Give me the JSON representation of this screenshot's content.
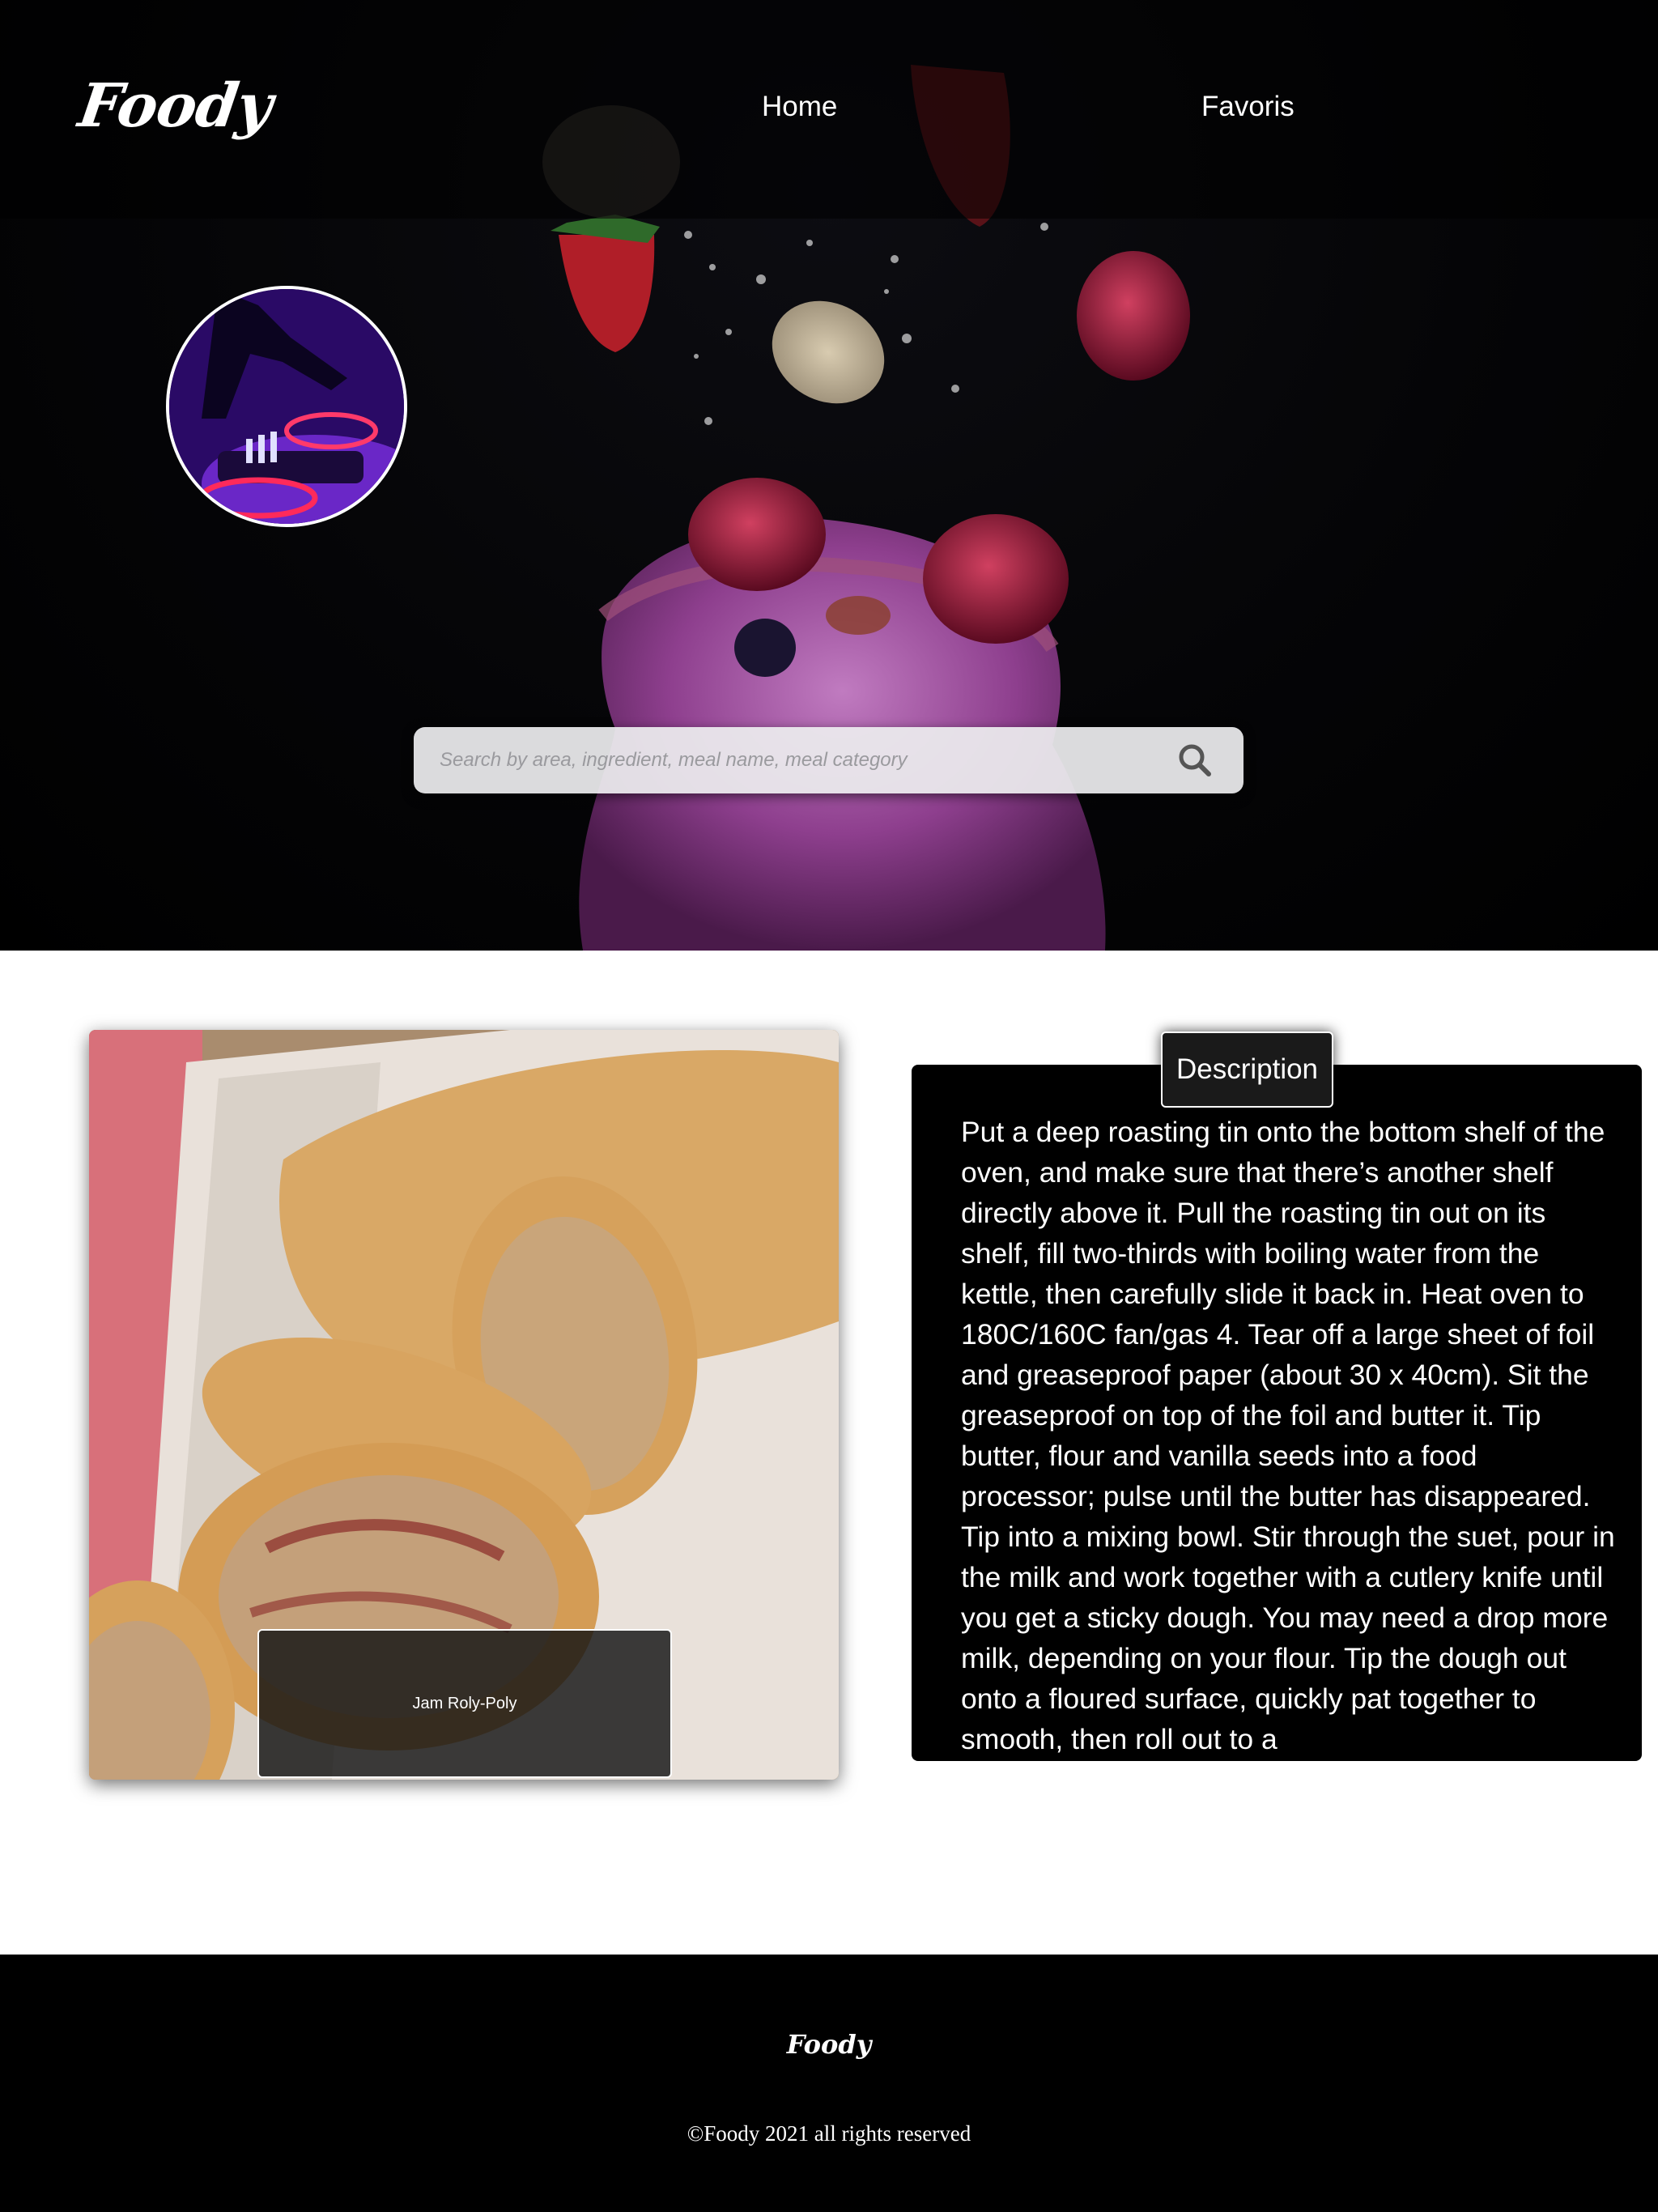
{
  "header": {
    "logo": "Foody",
    "nav": {
      "home": "Home",
      "favorites": "Favoris"
    }
  },
  "hero": {
    "search": {
      "placeholder": "Search by area, ingredient, meal name, meal category",
      "value": "",
      "icon": "search-icon"
    },
    "avatar_icon": "user-avatar"
  },
  "meal": {
    "name": "Jam Roly-Poly",
    "description_tab": "Description",
    "instructions": "Put a deep roasting tin onto the bottom shelf of the oven, and make sure that there’s another shelf directly above it. Pull the roasting tin out on its shelf, fill two-thirds with boiling water from the kettle, then carefully slide it back in. Heat oven to 180C/160C fan/gas 4. Tear off a large sheet of foil and greaseproof paper (about 30 x 40cm). Sit the greaseproof on top of the foil and butter it. Tip butter, flour and vanilla seeds into a food processor; pulse until the butter has disappeared. Tip into a mixing bowl. Stir through the suet, pour in the milk and work together with a cutlery knife until you get a sticky dough. You may need a drop more milk, depending on your flour. Tip the dough out onto a floured surface, quickly pat together to smooth, then roll out to a"
  },
  "footer": {
    "logo": "Foody",
    "copyright": "©Foody 2021 all rights reserved"
  },
  "colors": {
    "hero_background": "#000000",
    "search_background": "#ECECEE",
    "panel_background": "#000000",
    "footer_background": "#000000",
    "text_light": "#FFFFFF"
  }
}
